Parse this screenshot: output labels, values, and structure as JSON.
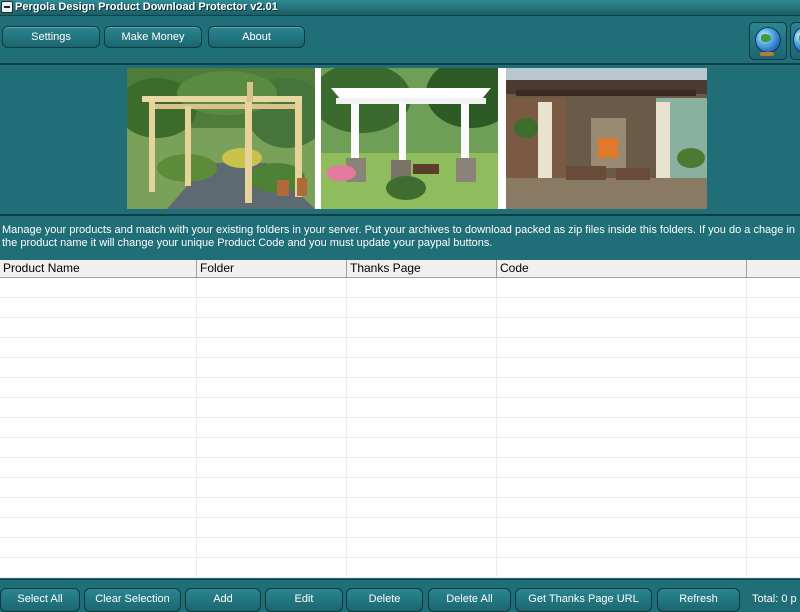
{
  "window": {
    "title": "Pergola Design Product Download Protector v2.01"
  },
  "toolbar": {
    "buttons": [
      "Settings",
      "Make Money",
      "About"
    ]
  },
  "info_text": "Manage your products and match with your existing folders in your server. Put your archives to download packed as zip files inside this folders. If you do a chage in the product name it will change your unique Product Code and you must update your paypal buttons.",
  "table": {
    "columns": [
      "Product Name",
      "Folder",
      "Thanks Page",
      "Code"
    ],
    "rows": []
  },
  "bottom": {
    "buttons": [
      "Select All",
      "Clear Selection",
      "Add",
      "Edit",
      "Delete",
      "Delete All",
      "Get Thanks Page URL",
      "Refresh"
    ],
    "total": "Total: 0 p"
  },
  "colors": {
    "background": "#1f6e78",
    "button": "#1b6670",
    "text": "#ffffff"
  },
  "icons": {
    "title": "app-menu-icon",
    "toolbar_right": "globe-icon"
  }
}
